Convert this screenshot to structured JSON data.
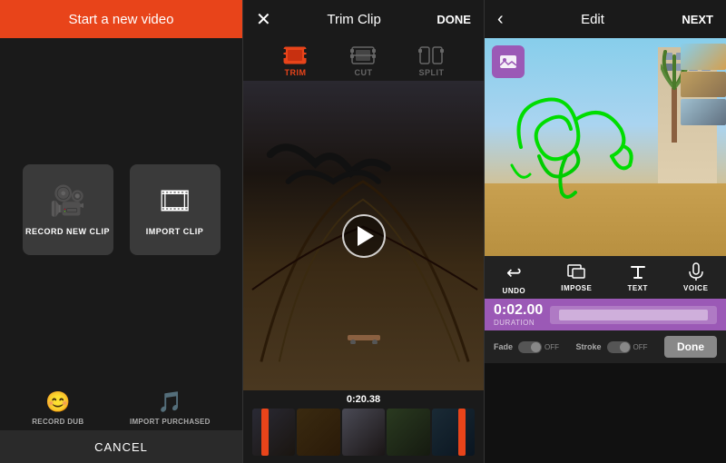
{
  "panel1": {
    "header": {
      "title": "Start a new video"
    },
    "record_btn": {
      "label": "RECORD NEW CLIP"
    },
    "import_btn": {
      "label": "IMPORT CLIP"
    },
    "record_dub_btn": {
      "label": "RECORD DUB"
    },
    "import_purchased_btn": {
      "label": "IMPORT PURCHASED"
    },
    "cancel_btn": {
      "label": "CANCEL"
    }
  },
  "panel2": {
    "header": {
      "title": "Trim Clip",
      "done_label": "DONE"
    },
    "tools": [
      {
        "label": "TRIM",
        "active": true
      },
      {
        "label": "CUT",
        "active": false
      },
      {
        "label": "SPLIT",
        "active": false
      }
    ],
    "timecode": "0:20.38"
  },
  "panel3": {
    "header": {
      "title": "Edit",
      "next_label": "NEXT"
    },
    "toolbar": [
      {
        "label": "UNDO"
      },
      {
        "label": "IMPOSE"
      },
      {
        "label": "TEXT"
      },
      {
        "label": "VOICE"
      }
    ],
    "duration": {
      "time": "0:02.00",
      "label": "DURATION"
    },
    "fade": {
      "label": "Fade",
      "state": "OFF"
    },
    "stroke": {
      "label": "Stroke",
      "state": "OFF"
    },
    "done_btn": {
      "label": "Done"
    }
  }
}
